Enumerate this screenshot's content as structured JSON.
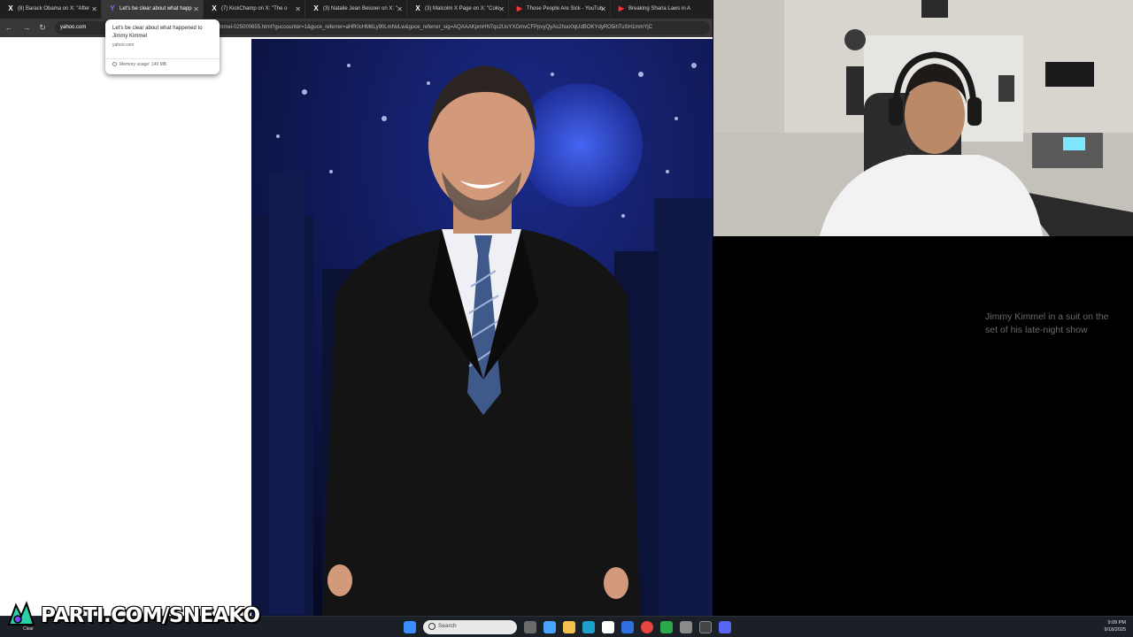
{
  "browser": {
    "tabs": [
      {
        "label": "(8) Barack Obama on X: \"After",
        "favicon": "x-icon",
        "active": false
      },
      {
        "label": "Let's be clear about what happ",
        "favicon": "yahoo-icon",
        "active": true
      },
      {
        "label": "(7) KickChamp on X: \"The o",
        "favicon": "x-icon",
        "active": false
      },
      {
        "label": "(3) Natalie Jean Beisner on X: \"",
        "favicon": "x-icon",
        "active": false
      },
      {
        "label": "(3) Malcolm X Page on X: \"Colo",
        "favicon": "x-icon",
        "active": false
      },
      {
        "label": "Those People Are Sick - YouTub",
        "favicon": "youtube-icon",
        "active": false
      },
      {
        "label": "Breaking Sharia Laws in A",
        "favicon": "youtube-icon",
        "active": false
      }
    ],
    "address": {
      "domain": "yahoo.com",
      "path": "mmel-025000655.html?guccounter=1&guce_referrer=aHR0cHM6Ly90LmNvLw&guce_referrer_sig=AQAAAKpmHN7qc2UoYXGmvCFPpvyQyAs2huo0qUdBOKYdyRO5ihTuSH1mmYjC"
    },
    "tab_hover_card": {
      "title": "Let's be clear about what happened to Jimmy Kimmel",
      "domain": "yahoo.com",
      "memory": "Memory usage: 149 MB"
    }
  },
  "article": {
    "image_caption": "Jimmy Kimmel in a suit on the set of his late-night show"
  },
  "overlay": {
    "brand": "PARTI.COM/SNEAKO",
    "clear_label": "Clear"
  },
  "taskbar": {
    "search_placeholder": "Search",
    "time": "9:09 PM",
    "date": "9/18/2025"
  },
  "colors": {
    "tab_strip": "#1f1f1f",
    "active_tab": "#383838",
    "taskbar": "#1b1f26",
    "photo_bg": "#0a0f2e",
    "caption_text": "#6b6b6b"
  }
}
